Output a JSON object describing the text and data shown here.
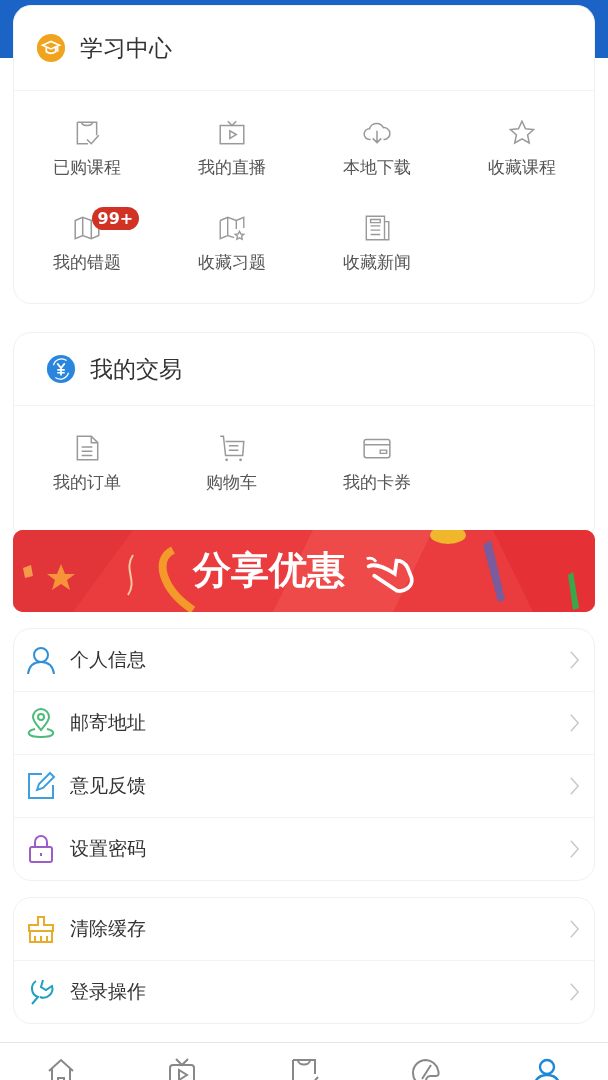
{
  "study_center": {
    "title": "学习中心",
    "items": [
      {
        "label": "已购课程"
      },
      {
        "label": "我的直播"
      },
      {
        "label": "本地下载"
      },
      {
        "label": "收藏课程"
      },
      {
        "label": "我的错题",
        "badge": "99+"
      },
      {
        "label": "收藏习题"
      },
      {
        "label": "收藏新闻"
      }
    ]
  },
  "transactions": {
    "title": "我的交易",
    "items": [
      {
        "label": "我的订单"
      },
      {
        "label": "购物车"
      },
      {
        "label": "我的卡券"
      }
    ]
  },
  "banner": {
    "kind": "picture",
    "text": "分享优惠"
  },
  "menu_groups": [
    [
      {
        "label": "个人信息",
        "color": "#2f8fd8"
      },
      {
        "label": "邮寄地址",
        "color": "#4cbb7a"
      },
      {
        "label": "意见反馈",
        "color": "#3d9ee0"
      },
      {
        "label": "设置密码",
        "color": "#9b5ec9"
      }
    ],
    [
      {
        "label": "清除缓存",
        "color": "#e9ac2a"
      },
      {
        "label": "登录操作",
        "color": "#1e9fc4"
      }
    ]
  ],
  "tab_bar": [
    {
      "selected": false
    },
    {
      "selected": false
    },
    {
      "selected": false
    },
    {
      "selected": false
    },
    {
      "selected": true
    }
  ]
}
